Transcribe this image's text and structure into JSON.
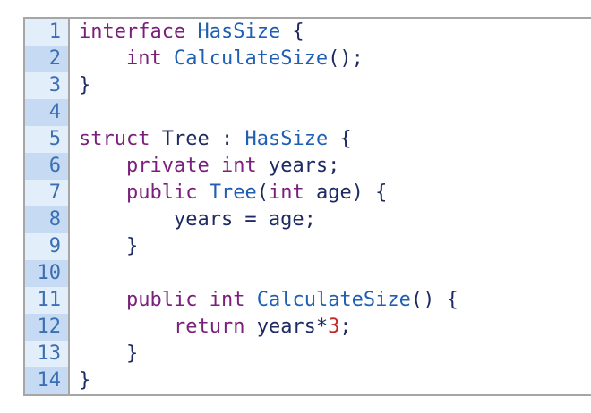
{
  "lines": [
    {
      "number": "1",
      "tokens": [
        {
          "t": "interface",
          "c": "kw"
        },
        {
          "t": " ",
          "c": "pn"
        },
        {
          "t": "HasSize",
          "c": "ty"
        },
        {
          "t": " {",
          "c": "pn"
        }
      ]
    },
    {
      "number": "2",
      "tokens": [
        {
          "t": "    ",
          "c": "pn"
        },
        {
          "t": "int",
          "c": "kw"
        },
        {
          "t": " ",
          "c": "pn"
        },
        {
          "t": "CalculateSize",
          "c": "ty"
        },
        {
          "t": "();",
          "c": "pn"
        }
      ]
    },
    {
      "number": "3",
      "tokens": [
        {
          "t": "}",
          "c": "pn"
        }
      ]
    },
    {
      "number": "4",
      "tokens": []
    },
    {
      "number": "5",
      "tokens": [
        {
          "t": "struct",
          "c": "kw"
        },
        {
          "t": " ",
          "c": "pn"
        },
        {
          "t": "Tree",
          "c": "id"
        },
        {
          "t": " : ",
          "c": "pn"
        },
        {
          "t": "HasSize",
          "c": "ty"
        },
        {
          "t": " {",
          "c": "pn"
        }
      ]
    },
    {
      "number": "6",
      "tokens": [
        {
          "t": "    ",
          "c": "pn"
        },
        {
          "t": "private",
          "c": "kw"
        },
        {
          "t": " ",
          "c": "pn"
        },
        {
          "t": "int",
          "c": "kw"
        },
        {
          "t": " years;",
          "c": "id"
        }
      ]
    },
    {
      "number": "7",
      "tokens": [
        {
          "t": "    ",
          "c": "pn"
        },
        {
          "t": "public",
          "c": "kw"
        },
        {
          "t": " ",
          "c": "pn"
        },
        {
          "t": "Tree",
          "c": "ty"
        },
        {
          "t": "(",
          "c": "pn"
        },
        {
          "t": "int",
          "c": "kw"
        },
        {
          "t": " age) {",
          "c": "id"
        }
      ]
    },
    {
      "number": "8",
      "tokens": [
        {
          "t": "        years = age;",
          "c": "id"
        }
      ]
    },
    {
      "number": "9",
      "tokens": [
        {
          "t": "    }",
          "c": "pn"
        }
      ]
    },
    {
      "number": "10",
      "tokens": []
    },
    {
      "number": "11",
      "tokens": [
        {
          "t": "    ",
          "c": "pn"
        },
        {
          "t": "public",
          "c": "kw"
        },
        {
          "t": " ",
          "c": "pn"
        },
        {
          "t": "int",
          "c": "kw"
        },
        {
          "t": " ",
          "c": "pn"
        },
        {
          "t": "CalculateSize",
          "c": "ty"
        },
        {
          "t": "() {",
          "c": "pn"
        }
      ]
    },
    {
      "number": "12",
      "tokens": [
        {
          "t": "        ",
          "c": "pn"
        },
        {
          "t": "return",
          "c": "kw"
        },
        {
          "t": " years*",
          "c": "id"
        },
        {
          "t": "3",
          "c": "num"
        },
        {
          "t": ";",
          "c": "pn"
        }
      ]
    },
    {
      "number": "13",
      "tokens": [
        {
          "t": "    }",
          "c": "pn"
        }
      ]
    },
    {
      "number": "14",
      "tokens": [
        {
          "t": "}",
          "c": "pn"
        }
      ]
    }
  ],
  "colors": {
    "keyword": "#7a1f7c",
    "type": "#1f5fb4",
    "identifier": "#1e2a63",
    "number": "#c62828",
    "gutter_text": "#3a6fb3",
    "gutter_odd": "#e3eefb",
    "gutter_even": "#c6daf3",
    "border": "#a6a6a6"
  }
}
